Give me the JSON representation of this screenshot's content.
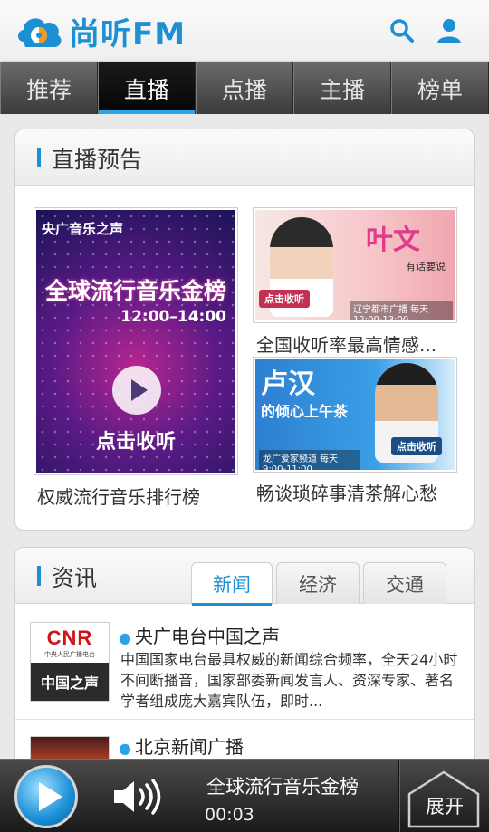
{
  "app": {
    "logo_text": "尚听FM"
  },
  "tabs": [
    {
      "label": "推荐"
    },
    {
      "label": "直播"
    },
    {
      "label": "点播"
    },
    {
      "label": "主播"
    },
    {
      "label": "榜单"
    }
  ],
  "preview_section": {
    "title": "直播预告",
    "big": {
      "tag": "央广音乐之声",
      "headline": "全球流行音乐金榜",
      "time": "12:00–14:00",
      "listen": "点击收听",
      "caption": "权威流行音乐排行榜"
    },
    "small": [
      {
        "name": "叶文",
        "sub": "有话要说",
        "button": "点击收听",
        "meta": "辽宁都市广播 每天12:00-13:00",
        "caption": "全国收听率最高情感..."
      },
      {
        "name": "卢汉",
        "sub": "的倾心上午茶",
        "button": "点击收听",
        "meta": "龙广爱家频道 每天9:00-11:00",
        "caption": "畅谈琐碎事清茶解心愁"
      }
    ]
  },
  "news_section": {
    "title": "资讯",
    "tabs": [
      {
        "label": "新闻"
      },
      {
        "label": "经济"
      },
      {
        "label": "交通"
      }
    ],
    "items": [
      {
        "logo_top": "CNR",
        "logo_small": "中央人民广播电台",
        "logo_bottom": "中国之声",
        "title": "央广电台中国之声",
        "desc": "中国国家电台最具权威的新闻综合频率，全天24小时不间断播音，国家部委新闻发言人、资深专家、著名学者组成庞大嘉宾队伍，即时..."
      },
      {
        "title": "北京新闻广播"
      }
    ]
  },
  "player": {
    "title": "全球流行音乐金榜",
    "time": "00:03",
    "expand_label": "展开"
  },
  "colors": {
    "accent": "#1d8fd3",
    "active_tab_underline": "#2aa3e8"
  }
}
